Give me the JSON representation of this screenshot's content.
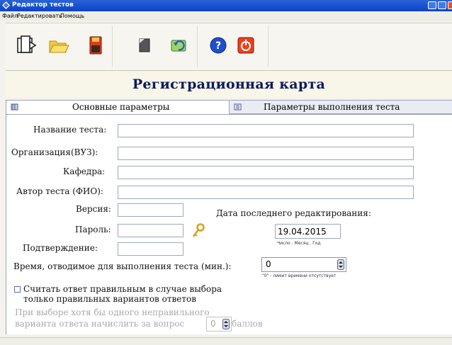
{
  "window": {
    "title": "Редактор тестов"
  },
  "menu": {
    "items": [
      "Файл",
      "Редактировать",
      "Помощь"
    ]
  },
  "toolbar": {
    "buttons": [
      "new-test-icon",
      "open-folder-icon",
      "save-icon",
      "document-icon",
      "refresh-icon",
      "help-icon",
      "exit-icon"
    ]
  },
  "heading": "Регистрационная карта",
  "tabs": [
    {
      "label": "Основные параметры",
      "active": true
    },
    {
      "label": "Параметры выполнения теста",
      "active": false
    }
  ],
  "form": {
    "test_name_label": "Название теста:",
    "test_name_value": "",
    "org_label": "Организация(ВУЗ):",
    "org_value": "",
    "dept_label": "Кафедра:",
    "dept_value": "",
    "author_label": "Автор теста (ФИО):",
    "author_value": "",
    "version_label": "Версия:",
    "version_value": "",
    "password_label": "Пароль:",
    "password_value": "",
    "confirm_label": "Подтверждение:",
    "confirm_value": "",
    "last_edit_label": "Дата последнего редактирования:",
    "last_edit_date": "19.04.2015",
    "date_hint": "Число . Месяц . Год",
    "time_label": "Время, отводимое для выполнения теста (мин.):",
    "time_value": "0",
    "time_hint": "\"0\" - лимит времени отсутствует",
    "correct_only_label_line1": "Считать ответ правильным в случае выбора",
    "correct_only_label_line2": "только правильных вариантов ответов",
    "correct_only_checked": false,
    "penalty_line1": "При выборе хотя бы одного неправильного",
    "penalty_line2": "варианта ответа начислить за вопрос",
    "penalty_value": "0",
    "penalty_unit": "баллов"
  },
  "colors": {
    "titlebar": "#0a43c8",
    "heading": "#0c1a5e",
    "disabled_text": "#a9a9a9"
  }
}
